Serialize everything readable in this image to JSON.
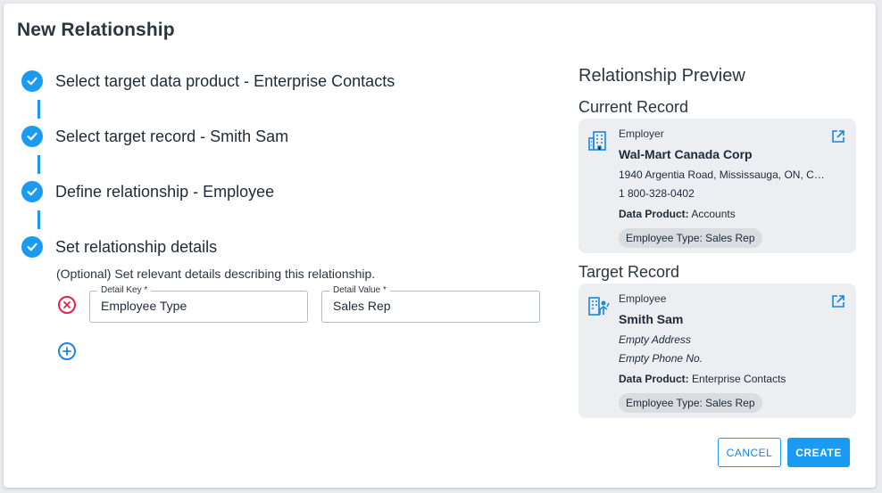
{
  "dialog": {
    "title": "New Relationship"
  },
  "steps": [
    {
      "label": "Select target data product - Enterprise Contacts"
    },
    {
      "label": "Select target record - Smith Sam"
    },
    {
      "label": "Define relationship - Employee"
    },
    {
      "label": "Set relationship details"
    }
  ],
  "details": {
    "optional_text": "(Optional) Set relevant details describing this relationship.",
    "key_label": "Detail Key *",
    "key_value": "Employee Type",
    "value_label": "Detail Value *",
    "value_value": "Sales Rep"
  },
  "preview": {
    "title": "Relationship Preview",
    "current": {
      "section": "Current Record",
      "type": "Employer",
      "name": "Wal-Mart Canada Corp",
      "address": "1940 Argentia Road, Mississauga, ON, CA,…",
      "phone": "1 800-328-0402",
      "dp_label": "Data Product:",
      "dp_value": "Accounts",
      "chip": "Employee Type: Sales Rep"
    },
    "target": {
      "section": "Target Record",
      "type": "Employee",
      "name": "Smith Sam",
      "address": "Empty Address",
      "phone": "Empty Phone No.",
      "dp_label": "Data Product:",
      "dp_value": "Enterprise Contacts",
      "chip": "Employee Type: Sales Rep"
    }
  },
  "actions": {
    "cancel": "CANCEL",
    "create": "CREATE"
  },
  "colors": {
    "accent": "#1a9af0",
    "danger": "#e0234e",
    "card_bg": "#eceef1"
  },
  "icons": {
    "step": "check-circle-icon",
    "remove": "remove-circle-icon",
    "add": "add-circle-icon",
    "employer": "building-icon",
    "employee": "person-icon",
    "external": "external-link-icon"
  }
}
